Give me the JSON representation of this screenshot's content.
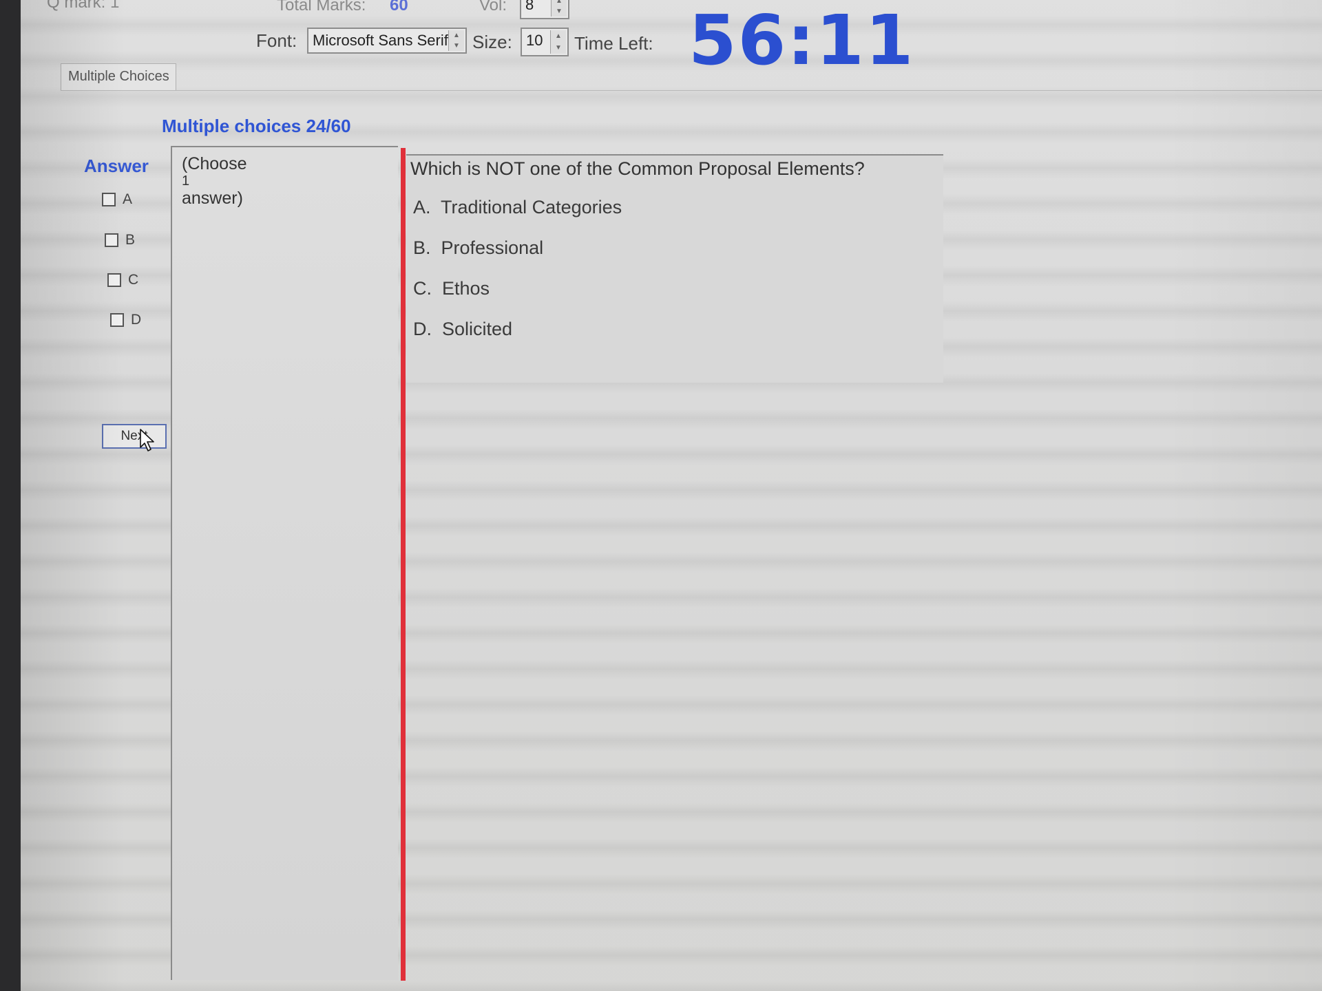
{
  "header": {
    "q_mark_label": "Q mark: 1",
    "total_marks_label": "Total Marks:",
    "total_marks_value": "60",
    "vol_label": "Vol:",
    "vol_value": "8",
    "font_label": "Font:",
    "font_value": "Microsoft Sans Serif",
    "size_label": "Size:",
    "size_value": "10",
    "time_left_label": "Time Left:",
    "timer_value": "56:11"
  },
  "tabs": [
    {
      "label": "Multiple Choices"
    }
  ],
  "quiz": {
    "section_title": "Multiple choices 24/60",
    "answer_title": "Answer",
    "choose_hint_line1": "(Choose",
    "choose_hint_line2": "1",
    "choose_hint_line3": "answer)",
    "question": "Which is NOT one of the Common Proposal Elements?",
    "options": [
      {
        "letter": "A",
        "label": "A.",
        "text": "Traditional Categories"
      },
      {
        "letter": "B",
        "label": "B.",
        "text": "Professional"
      },
      {
        "letter": "C",
        "label": "C.",
        "text": "Ethos"
      },
      {
        "letter": "D",
        "label": "D.",
        "text": "Solicited"
      }
    ],
    "next_label": "Next"
  },
  "colors": {
    "accent_blue": "#2f55d4",
    "timer_blue": "#2b4fd0",
    "divider_red": "#e0303a"
  }
}
